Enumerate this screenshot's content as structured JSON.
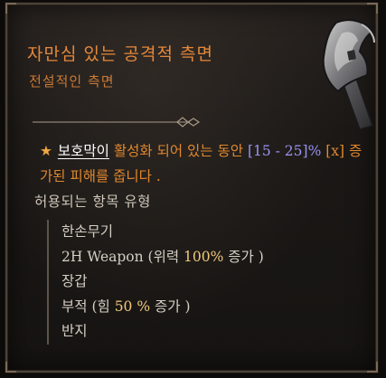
{
  "item": {
    "name": "자만심 있는 공격적 측면",
    "type": "전설적인 측면",
    "art_icon": "axe-icon"
  },
  "affix": {
    "star": "★",
    "keyword": "보호막이",
    "part1": " 활성화 되어 있는 동안 ",
    "range": "[15 - 25]%",
    "part2": " [x] 증가된 피해를 줍니다 ."
  },
  "allowed": {
    "title": "허용되는 항목 유형",
    "items": [
      {
        "label": "한손무기"
      },
      {
        "label": "2H Weapon (위력 ",
        "value": "100%",
        "suffix": " 증가 )"
      },
      {
        "label": "장갑"
      },
      {
        "label": "부적 (힘 ",
        "value": "50 %",
        "suffix": " 증가 )"
      },
      {
        "label": "반지"
      }
    ]
  },
  "colors": {
    "legendary_orange": "#e5883a",
    "range_purple": "#9c93f2",
    "value_gold": "#f2c97a",
    "border": "#4b4238"
  }
}
